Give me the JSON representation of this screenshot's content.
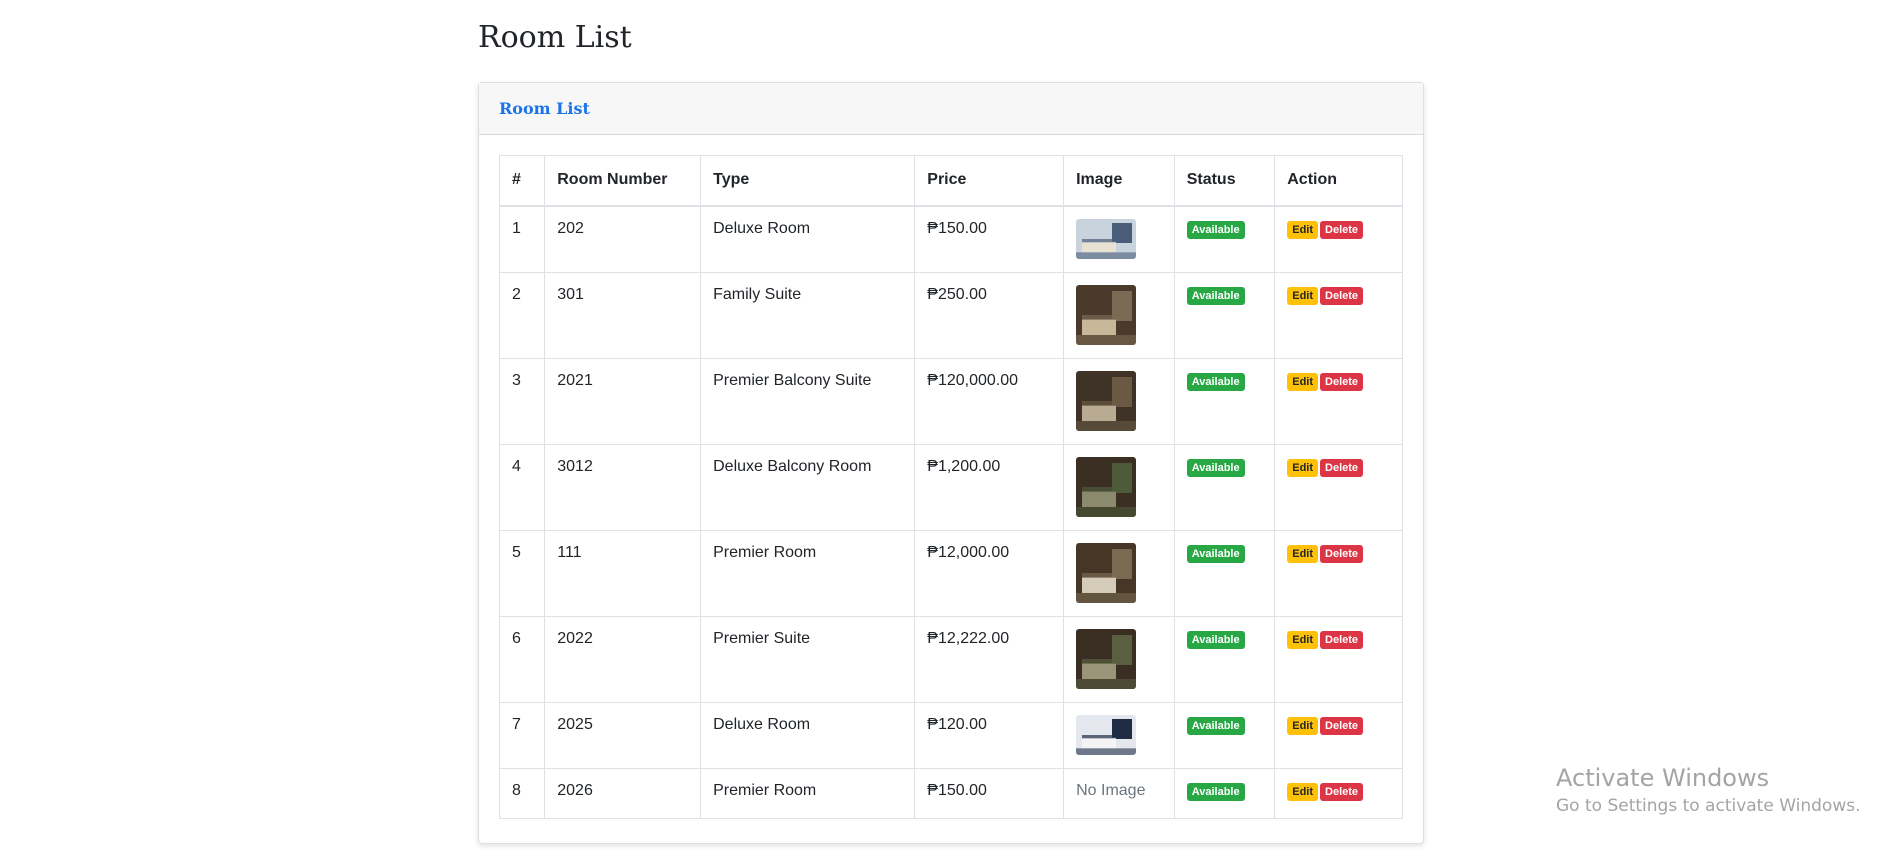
{
  "page": {
    "title": "Room List"
  },
  "card": {
    "header_title": "Room List"
  },
  "table": {
    "headers": [
      "#",
      "Room Number",
      "Type",
      "Price",
      "Image",
      "Status",
      "Action"
    ],
    "action_labels": {
      "edit": "Edit",
      "delete": "Delete"
    },
    "rows": [
      {
        "index": "1",
        "room_number": "202",
        "type": "Deluxe Room",
        "price": "₱150.00",
        "image": "bedroom-thumbnail",
        "status": "Available"
      },
      {
        "index": "2",
        "room_number": "301",
        "type": "Family Suite",
        "price": "₱250.00",
        "image": "bedroom-thumbnail",
        "status": "Available"
      },
      {
        "index": "3",
        "room_number": "2021",
        "type": "Premier Balcony Suite",
        "price": "₱120,000.00",
        "image": "bedroom-thumbnail",
        "status": "Available"
      },
      {
        "index": "4",
        "room_number": "3012",
        "type": "Deluxe Balcony Room",
        "price": "₱1,200.00",
        "image": "bedroom-thumbnail",
        "status": "Available"
      },
      {
        "index": "5",
        "room_number": "111",
        "type": "Premier Room",
        "price": "₱12,000.00",
        "image": "bedroom-thumbnail",
        "status": "Available"
      },
      {
        "index": "6",
        "room_number": "2022",
        "type": "Premier Suite",
        "price": "₱12,222.00",
        "image": "bedroom-thumbnail",
        "status": "Available"
      },
      {
        "index": "7",
        "room_number": "2025",
        "type": "Deluxe Room",
        "price": "₱120.00",
        "image": "bedroom-thumbnail",
        "status": "Available"
      },
      {
        "index": "8",
        "room_number": "2026",
        "type": "Premier Room",
        "price": "₱150.00",
        "image": "No Image",
        "status": "Available"
      }
    ]
  },
  "watermark": {
    "title": "Activate Windows",
    "subtitle": "Go to Settings to activate Windows."
  },
  "colors": {
    "header_link": "#1a73e8",
    "status_available": "#28a745",
    "edit_button": "#ffc107",
    "delete_button": "#dc3545"
  }
}
